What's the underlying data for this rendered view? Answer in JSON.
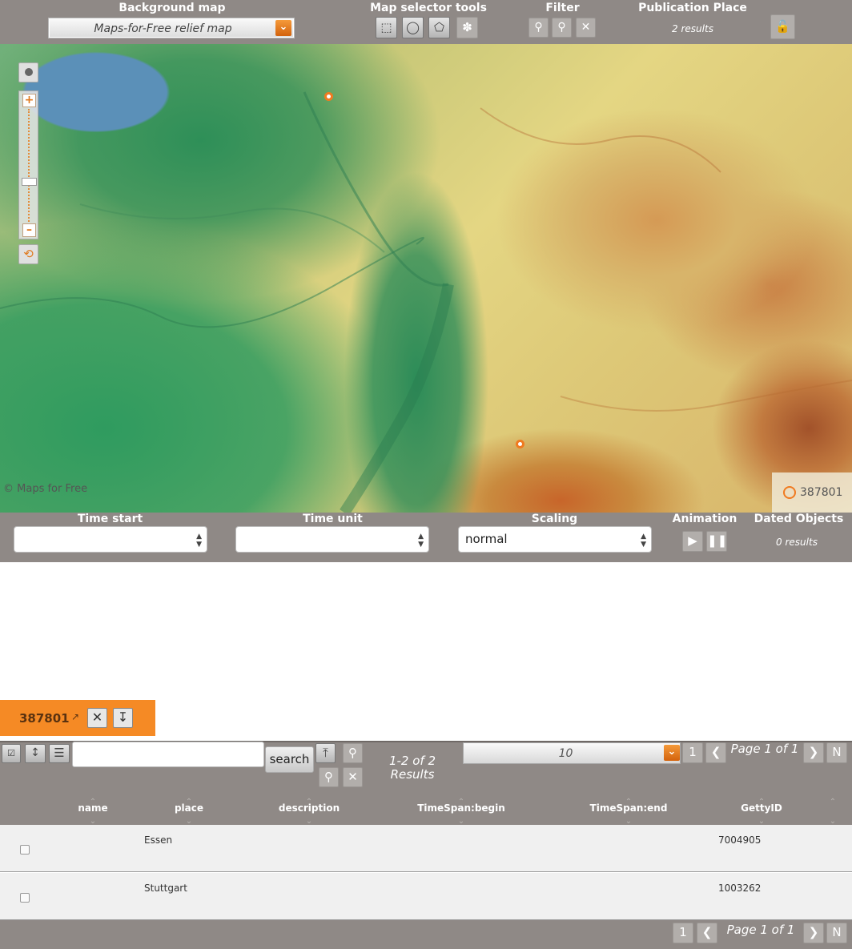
{
  "toolbar": {
    "background_map_label": "Background map",
    "background_map_value": "Maps-for-Free relief map",
    "selector_tools_label": "Map selector tools",
    "filter_label": "Filter",
    "publication_place_label": "Publication Place",
    "publication_place_count": "2 results"
  },
  "map": {
    "attribution": "© Maps for Free",
    "legend_label": "387801"
  },
  "timebar": {
    "time_start_label": "Time start",
    "time_unit_label": "Time unit",
    "scaling_label": "Scaling",
    "scaling_value": "normal",
    "animation_label": "Animation",
    "dated_objects_label": "Dated Objects",
    "dated_objects_count": "0 results"
  },
  "result_tab": {
    "id": "387801"
  },
  "grid": {
    "search_label": "search",
    "results_count": "1-2 of 2 Results",
    "page_size": "10",
    "first_page": "1",
    "last_page": "N",
    "page_info": "Page 1 of 1",
    "columns": [
      "name",
      "place",
      "description",
      "TimeSpan:begin",
      "TimeSpan:end",
      "GettyID"
    ],
    "rows": [
      {
        "name": "",
        "place": "Essen",
        "description": "",
        "begin": "",
        "end": "",
        "getty": "7004905"
      },
      {
        "name": "",
        "place": "Stuttgart",
        "description": "",
        "begin": "",
        "end": "",
        "getty": "1003262"
      }
    ],
    "footer_page_info": "Page 1 of 1",
    "footer_first_page": "1",
    "footer_last_page": "N"
  },
  "colors": {
    "toolbar_bg": "#8f8986",
    "accent": "#f58a25"
  }
}
